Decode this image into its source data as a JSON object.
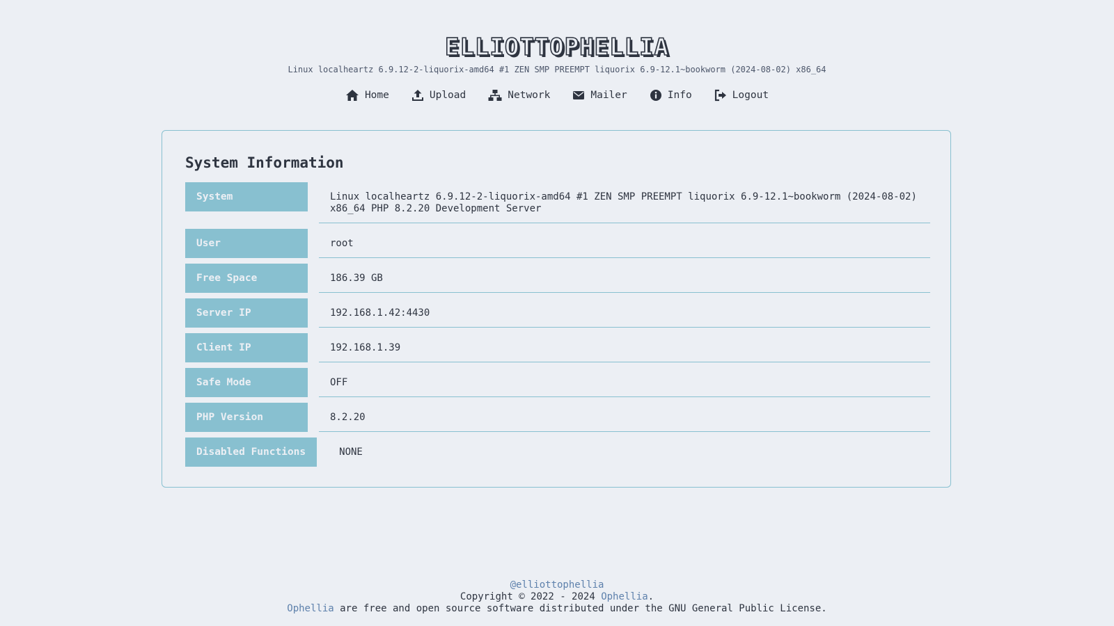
{
  "header": {
    "logo": "ELLIOTTOPHELLIA",
    "uname": "Linux localheartz 6.9.12-2-liquorix-amd64 #1 ZEN SMP PREEMPT liquorix 6.9-12.1~bookworm (2024-08-02) x86_64"
  },
  "nav": {
    "items": [
      {
        "label": "Home",
        "icon": "home-icon"
      },
      {
        "label": "Upload",
        "icon": "upload-icon"
      },
      {
        "label": "Network",
        "icon": "network-icon"
      },
      {
        "label": "Mailer",
        "icon": "envelope-icon"
      },
      {
        "label": "Info",
        "icon": "info-icon"
      },
      {
        "label": "Logout",
        "icon": "logout-icon"
      }
    ]
  },
  "panel": {
    "title": "System Information",
    "rows": [
      {
        "key": "System",
        "value_line1": "Linux localheartz 6.9.12-2-liquorix-amd64 #1 ZEN SMP PREEMPT liquorix 6.9-12.1~bookworm (2024-08-02)",
        "value_line2": "x86_64 PHP 8.2.20 Development Server"
      },
      {
        "key": "User",
        "value": "root"
      },
      {
        "key": "Free Space",
        "value": "186.39 GB"
      },
      {
        "key": "Server IP",
        "value": "192.168.1.42:4430"
      },
      {
        "key": "Client IP",
        "value": "192.168.1.39"
      },
      {
        "key": "Safe Mode",
        "value": "OFF"
      },
      {
        "key": "PHP Version",
        "value": "8.2.20"
      },
      {
        "key": "Disabled Functions",
        "value": "NONE"
      }
    ]
  },
  "footer": {
    "handle": "@elliottophellia",
    "copyright_prefix": "Copyright © 2022 - 2024 ",
    "copyright_link": "Ophellia",
    "copyright_suffix": ".",
    "license_link": "Ophellia",
    "license_text": " are free and open source software distributed under the GNU General Public License."
  },
  "colors": {
    "background": "#eceff4",
    "accent": "#88c0d0",
    "text": "#2e3440",
    "link": "#5e81ac"
  }
}
